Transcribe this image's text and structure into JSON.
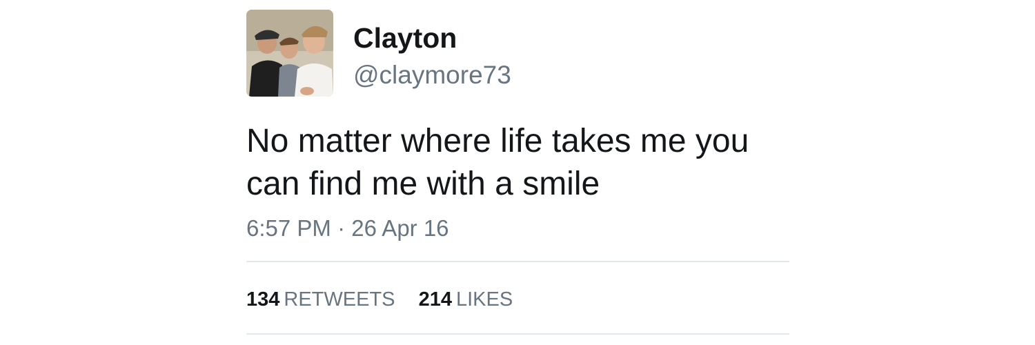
{
  "author": {
    "name": "Clayton",
    "handle": "@claymore73",
    "avatar_icon": "profile-photo-avatar"
  },
  "tweet": {
    "text": "No matter where life takes me you can find me with a smile",
    "time": "6:57 PM",
    "separator": "·",
    "date": "26 Apr 16"
  },
  "stats": {
    "retweets_count": "134",
    "retweets_label": "RETWEETS",
    "likes_count": "214",
    "likes_label": "LIKES"
  },
  "colors": {
    "primary_text": "#14171a",
    "secondary_text": "#66757f",
    "divider": "#e1e8ed"
  }
}
